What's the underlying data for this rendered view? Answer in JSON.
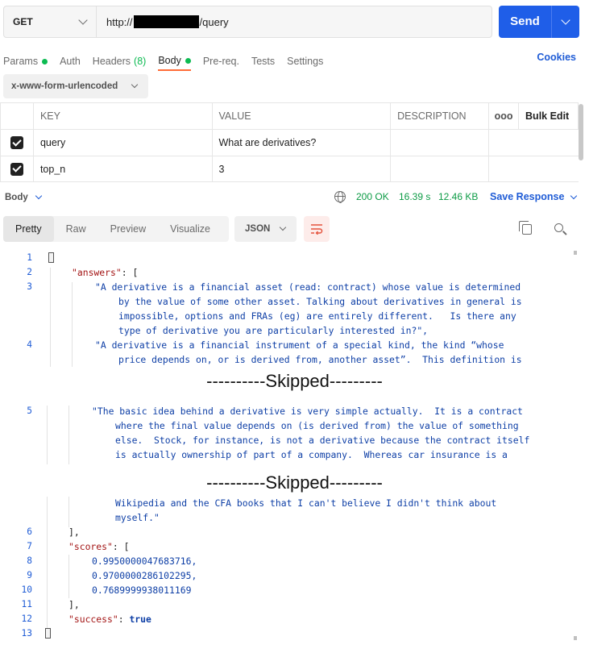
{
  "request": {
    "method": "GET",
    "url_prefix": "http://",
    "url_suffix": "/query",
    "send_label": "Send"
  },
  "tabs": {
    "params": "Params",
    "auth": "Auth",
    "headers": "Headers",
    "headers_count": "(8)",
    "body": "Body",
    "prereq": "Pre-req.",
    "tests": "Tests",
    "settings": "Settings",
    "cookies": "Cookies"
  },
  "body_type": "x-www-form-urlencoded",
  "table": {
    "headers": [
      "KEY",
      "VALUE",
      "DESCRIPTION",
      "ooo",
      "Bulk Edit"
    ],
    "rows": [
      {
        "key": "query",
        "value": "What are derivatives?",
        "description": ""
      },
      {
        "key": "top_n",
        "value": "3",
        "description": ""
      }
    ]
  },
  "response": {
    "body_label": "Body",
    "status": "200 OK",
    "time": "16.39 s",
    "size": "12.46 KB",
    "save_label": "Save Response"
  },
  "viewer": {
    "tabs": [
      "Pretty",
      "Raw",
      "Preview",
      "Visualize"
    ],
    "format": "JSON"
  },
  "code": {
    "lines": [
      "1",
      "2",
      "3",
      "4",
      "5",
      "6",
      "7",
      "8",
      "9",
      "10",
      "11",
      "12",
      "13"
    ],
    "answers_key": "\"answers\"",
    "ans1": [
      "\"A derivative is a financial asset (read: contract) whose value is determined",
      "by the value of some other asset. Talking about derivatives in general is",
      "impossible, options and FRAs (eg) are entirely different.   Is there any",
      "type of derivative you are particularly interested in?\","
    ],
    "ans2": [
      "\"A derivative is a financial instrument of a special kind, the kind “whose",
      "price depends on, or is derived from, another asset”.  This definition is"
    ],
    "ans3": [
      "\"The basic idea behind a derivative is very simple actually.  It is a contract",
      "where the final value depends on (is derived from) the value of something",
      "else.  Stock, for instance, is not a derivative because the contract itself",
      "is actually ownership of part of a company.  Whereas car insurance is a"
    ],
    "ans3_tail": [
      "Wikipedia and the CFA books that I can't believe I didn't think about",
      "myself.\""
    ],
    "scores_key": "\"scores\"",
    "scores": [
      "0.9950000047683716,",
      "0.9700000286102295,",
      "0.7689999938011169"
    ],
    "success_key": "\"success\"",
    "success_value": "true"
  },
  "skipped_label": "----------Skipped---------"
}
